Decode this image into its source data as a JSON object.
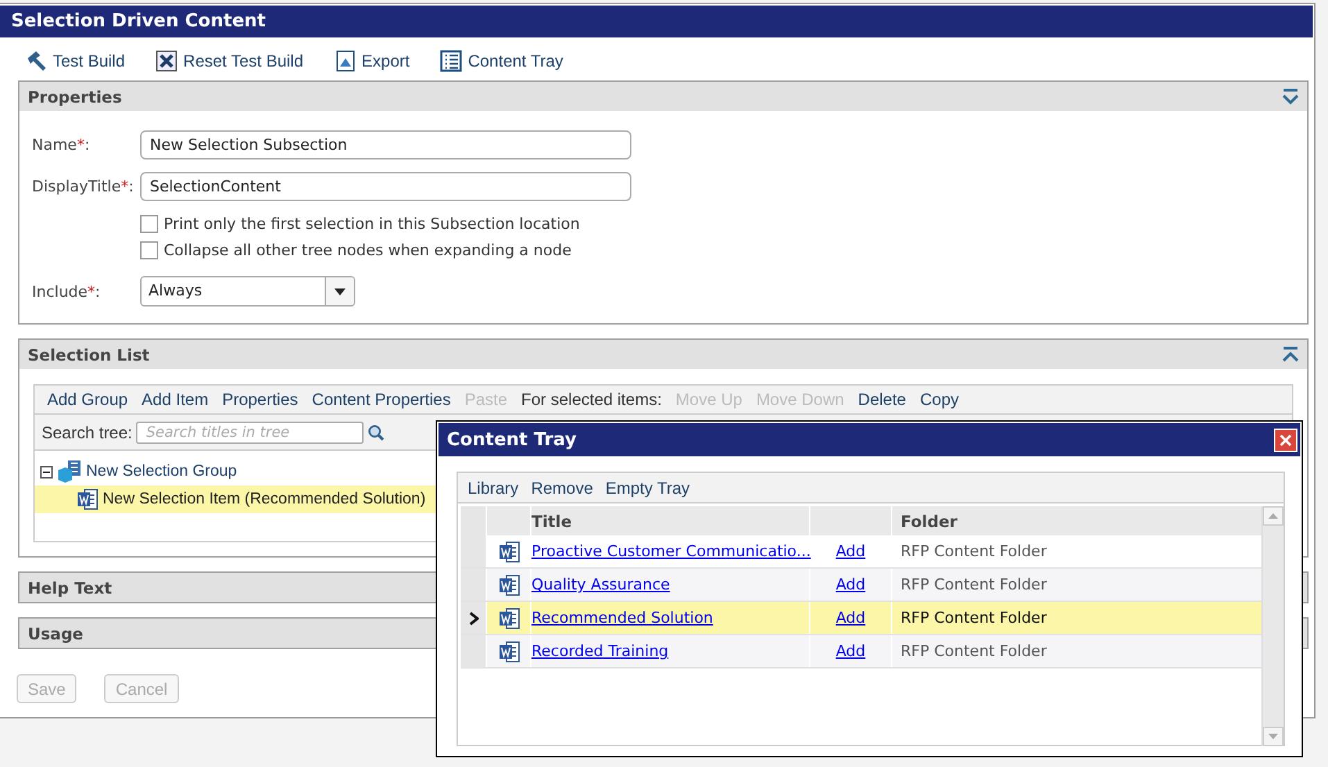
{
  "window": {
    "title": "Selection Driven Content"
  },
  "toolbar": [
    {
      "kind": "hammer",
      "label": "Test Build"
    },
    {
      "kind": "reset",
      "label": "Reset Test Build"
    },
    {
      "kind": "export",
      "label": "Export"
    },
    {
      "kind": "tray",
      "label": "Content Tray"
    }
  ],
  "properties": {
    "title": "Properties",
    "kind": "down",
    "fields": [
      {
        "label": "Name",
        "required_mark": "*",
        "separator": ":",
        "value": "New Selection Subsection"
      },
      {
        "label": "DisplayTitle",
        "required_mark": "*",
        "separator": ":",
        "value": "SelectionContent"
      }
    ],
    "checkboxes": [
      {
        "label": "Print only the first selection in this Subsection location",
        "checked": false
      },
      {
        "label": "Collapse all other tree nodes when expanding a node",
        "checked": false
      }
    ],
    "include": {
      "label": "Include",
      "required_mark": "*",
      "separator": ":",
      "value": "Always"
    }
  },
  "selection_list": {
    "title": "Selection List",
    "kind": "up",
    "actions": [
      {
        "kind": "link",
        "label": "Add Group",
        "disabled": false
      },
      {
        "kind": "link",
        "label": "Add Item",
        "disabled": false
      },
      {
        "kind": "link",
        "label": "Properties",
        "disabled": false
      },
      {
        "kind": "link",
        "label": "Content Properties",
        "disabled": false
      },
      {
        "kind": "link",
        "label": "Paste",
        "disabled": true
      },
      {
        "kind": "text",
        "label": "For selected items:"
      },
      {
        "kind": "link",
        "label": "Move Up",
        "disabled": true
      },
      {
        "kind": "link",
        "label": "Move Down",
        "disabled": true
      },
      {
        "kind": "link",
        "label": "Delete",
        "disabled": false
      },
      {
        "kind": "link",
        "label": "Copy",
        "disabled": false
      }
    ],
    "search": {
      "label": "Search tree:",
      "placeholder": "Search titles in tree"
    },
    "tree": [
      {
        "kind": "group",
        "label": "New Selection Group",
        "expanded": true,
        "selected": false,
        "children": [
          {
            "kind": "item",
            "label": "New Selection Item (Recommended Solution)",
            "selected": true
          }
        ]
      }
    ]
  },
  "collapsed_panels": [
    {
      "title": "Help Text"
    },
    {
      "title": "Usage"
    }
  ],
  "buttons": [
    {
      "label": "Save",
      "disabled": true
    },
    {
      "label": "Cancel",
      "disabled": true
    }
  ],
  "dialog": {
    "title": "Content Tray",
    "actions": [
      "Library",
      "Remove",
      "Empty Tray"
    ],
    "columns": [
      "Title",
      "Folder"
    ],
    "rows": [
      {
        "title": "Proactive Customer Communicatio...",
        "action": "Add",
        "folder": "RFP Content Folder",
        "selected": false
      },
      {
        "title": "Quality Assurance",
        "action": "Add",
        "folder": "RFP Content Folder",
        "selected": false
      },
      {
        "title": "Recommended Solution",
        "action": "Add",
        "folder": "RFP Content Folder",
        "selected": true
      },
      {
        "title": "Recorded Training",
        "action": "Add",
        "folder": "RFP Content Folder",
        "selected": false
      }
    ]
  }
}
